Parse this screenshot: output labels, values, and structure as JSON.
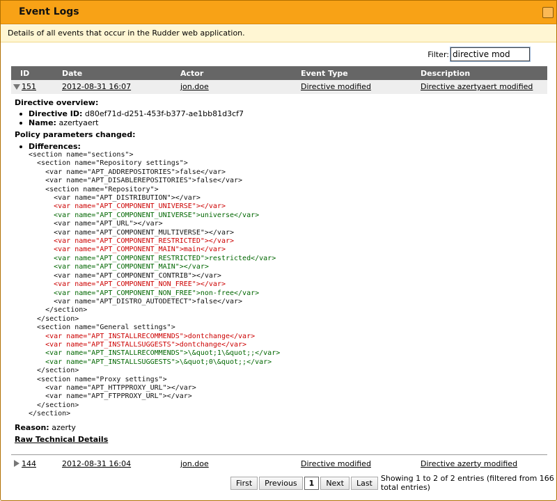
{
  "window": {
    "title": "Event Logs",
    "subtitle": "Details of all events that occur in the Rudder web application."
  },
  "filter": {
    "label": "Filter:",
    "value": "directive mod"
  },
  "table": {
    "columns": [
      "ID",
      "Date",
      "Actor",
      "Event Type",
      "Description"
    ],
    "rows": [
      {
        "id": "151",
        "date": "2012-08-31 16:07",
        "actor": "jon.doe",
        "type": "Directive modified",
        "description": "Directive azertyaert modified",
        "expanded": true
      },
      {
        "id": "144",
        "date": "2012-08-31 16:04",
        "actor": "jon.doe",
        "type": "Directive modified",
        "description": "Directive azerty modified",
        "expanded": false
      }
    ]
  },
  "details": {
    "overview_title": "Directive overview:",
    "directive_id_label": "Directive ID:",
    "directive_id": "d80ef71d-d251-453f-b377-ae1bb81d3cf7",
    "name_label": "Name:",
    "name": "azertyaert",
    "params_title": "Policy parameters changed:",
    "differences_label": "Differences:",
    "xml_lines": [
      {
        "kind": "eq",
        "text": "<section name=\"sections\">"
      },
      {
        "kind": "eq",
        "text": "  <section name=\"Repository settings\">"
      },
      {
        "kind": "eq",
        "text": "    <var name=\"APT_ADDREPOSITORIES\">false</var>"
      },
      {
        "kind": "eq",
        "text": "    <var name=\"APT_DISABLEREPOSITORIES\">false</var>"
      },
      {
        "kind": "eq",
        "text": "    <section name=\"Repository\">"
      },
      {
        "kind": "eq",
        "text": "      <var name=\"APT_DISTRIBUTION\"></var>"
      },
      {
        "kind": "del",
        "text": "      <var name=\"APT_COMPONENT_UNIVERSE\"></var>"
      },
      {
        "kind": "add",
        "text": "      <var name=\"APT_COMPONENT_UNIVERSE\">universe</var>"
      },
      {
        "kind": "eq",
        "text": "      <var name=\"APT_URL\"></var>"
      },
      {
        "kind": "eq",
        "text": "      <var name=\"APT_COMPONENT_MULTIVERSE\"></var>"
      },
      {
        "kind": "del",
        "text": "      <var name=\"APT_COMPONENT_RESTRICTED\"></var>"
      },
      {
        "kind": "del",
        "text": "      <var name=\"APT_COMPONENT_MAIN\">main</var>"
      },
      {
        "kind": "add",
        "text": "      <var name=\"APT_COMPONENT_RESTRICTED\">restricted</var>"
      },
      {
        "kind": "add",
        "text": "      <var name=\"APT_COMPONENT_MAIN\"></var>"
      },
      {
        "kind": "eq",
        "text": "      <var name=\"APT_COMPONENT_CONTRIB\"></var>"
      },
      {
        "kind": "del",
        "text": "      <var name=\"APT_COMPONENT_NON_FREE\"></var>"
      },
      {
        "kind": "add",
        "text": "      <var name=\"APT_COMPONENT_NON_FREE\">non-free</var>"
      },
      {
        "kind": "eq",
        "text": "      <var name=\"APT_DISTRO_AUTODETECT\">false</var>"
      },
      {
        "kind": "eq",
        "text": "    </section>"
      },
      {
        "kind": "eq",
        "text": "  </section>"
      },
      {
        "kind": "eq",
        "text": "  <section name=\"General settings\">"
      },
      {
        "kind": "del",
        "text": "    <var name=\"APT_INSTALLRECOMMENDS\">dontchange</var>"
      },
      {
        "kind": "del",
        "text": "    <var name=\"APT_INSTALLSUGGESTS\">dontchange</var>"
      },
      {
        "kind": "add",
        "text": "    <var name=\"APT_INSTALLRECOMMENDS\">\\&quot;1\\&quot;;</var>"
      },
      {
        "kind": "add",
        "text": "    <var name=\"APT_INSTALLSUGGESTS\">\\&quot;0\\&quot;;</var>"
      },
      {
        "kind": "eq",
        "text": "  </section>"
      },
      {
        "kind": "eq",
        "text": "  <section name=\"Proxy settings\">"
      },
      {
        "kind": "eq",
        "text": "    <var name=\"APT_HTTPPROXY_URL\"></var>"
      },
      {
        "kind": "eq",
        "text": "    <var name=\"APT_FTPPROXY_URL\"></var>"
      },
      {
        "kind": "eq",
        "text": "  </section>"
      },
      {
        "kind": "eq",
        "text": "</section>"
      }
    ],
    "reason_label": "Reason:",
    "reason": "azerty",
    "raw_link": "Raw Technical Details"
  },
  "pager": {
    "first": "First",
    "previous": "Previous",
    "current": "1",
    "next": "Next",
    "last": "Last",
    "info": "Showing 1 to 2 of 2 entries (filtered from 166 total entries)"
  },
  "colors": {
    "title_bar": "#f8a216",
    "subtitle_bg": "#fff6d3",
    "header_bg": "#666666",
    "diff_removed": "#cc0000",
    "diff_added": "#006600"
  }
}
